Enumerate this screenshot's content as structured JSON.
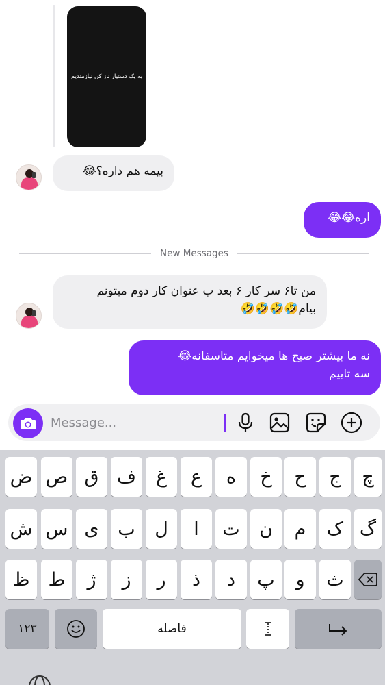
{
  "chat": {
    "story_text": "به یک دستیار ناز کن نیازمندیم",
    "divider_label": "New Messages",
    "messages": [
      {
        "text": "بیمه هم داره؟😂"
      },
      {
        "text": "اره😂😂"
      },
      {
        "line1": "من تا۶ سر کار ۶ بعد ب عنوان کار دوم میتونم",
        "line2": "بیام🤣🤣🤣🤣"
      },
      {
        "line1": "نه ما بیشتر صبح ها میخوایم متاسفانه😂",
        "line2": "سه تاییم"
      }
    ]
  },
  "composer": {
    "placeholder": "Message...",
    "icons": [
      "camera-icon",
      "microphone-icon",
      "gallery-icon",
      "sticker-icon",
      "plus-icon"
    ]
  },
  "keyboard": {
    "row1": [
      "ض",
      "ص",
      "ق",
      "ف",
      "غ",
      "ع",
      "ه",
      "خ",
      "ح",
      "ج",
      "چ"
    ],
    "row2": [
      "ش",
      "س",
      "ی",
      "ب",
      "ل",
      "ا",
      "ت",
      "ن",
      "م",
      "ک",
      "گ"
    ],
    "row3": [
      "ظ",
      "ط",
      "ژ",
      "ز",
      "ر",
      "ذ",
      "د",
      "پ",
      "و",
      "ث"
    ],
    "numbers_label": "۱۲۳",
    "space_label": "فاصله",
    "colors": {
      "accent": "#7c2ff5",
      "keyboard_bg": "#d2d3d8",
      "key_gray": "#abaeb6"
    }
  }
}
